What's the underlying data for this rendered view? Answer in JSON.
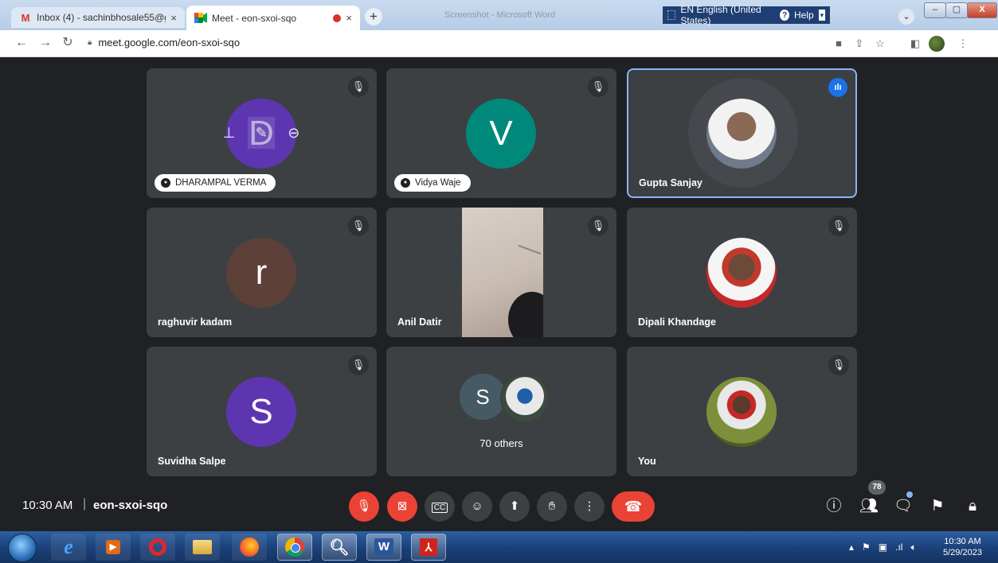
{
  "browser": {
    "tabs": [
      {
        "title": "Inbox (4) - sachinbhosale55@gm",
        "close": "×"
      },
      {
        "title": "Meet - eon-sxoi-sqo",
        "close": "×"
      }
    ],
    "new_tab": "+",
    "faded_window_title": "Screenshot - Microsoft Word",
    "language_bar": {
      "text": "EN English (United States)",
      "help": "Help"
    },
    "tab_search": "⌄",
    "url": "meet.google.com/eon-sxoi-sqo"
  },
  "participants": [
    {
      "name": "DHARAMPAL VERMA",
      "initial": "D",
      "color": "#5e35b1",
      "muted": true,
      "pinned": true
    },
    {
      "name": "Vidya Waje",
      "initial": "V",
      "color": "#00897b",
      "muted": true,
      "pinned": true
    },
    {
      "name": "Gupta Sanjay",
      "speaking": true
    },
    {
      "name": "raghuvir kadam",
      "initial": "r",
      "color": "#5d4037",
      "muted": true
    },
    {
      "name": "Anil Datir",
      "muted": true,
      "video": true
    },
    {
      "name": "Dipali Khandage",
      "muted": true
    },
    {
      "name": "Suvidha Salpe",
      "initial": "S",
      "color": "#5e35b1",
      "muted": true
    },
    {
      "name": "70 others",
      "initial": "S",
      "color": "#455a64"
    },
    {
      "name": "You",
      "muted": true
    }
  ],
  "meeting": {
    "time": "10:30 AM",
    "separator": "|",
    "code": "eon-sxoi-sqo",
    "people_count": "78"
  },
  "taskbar": {
    "clock_time": "10:30 AM",
    "clock_date": "5/29/2023",
    "word_label": "W"
  },
  "colors": {
    "meet_bg": "#202124",
    "tile_bg": "#3c4043",
    "danger": "#ea4335",
    "speaking_border": "#8ab4f8"
  }
}
